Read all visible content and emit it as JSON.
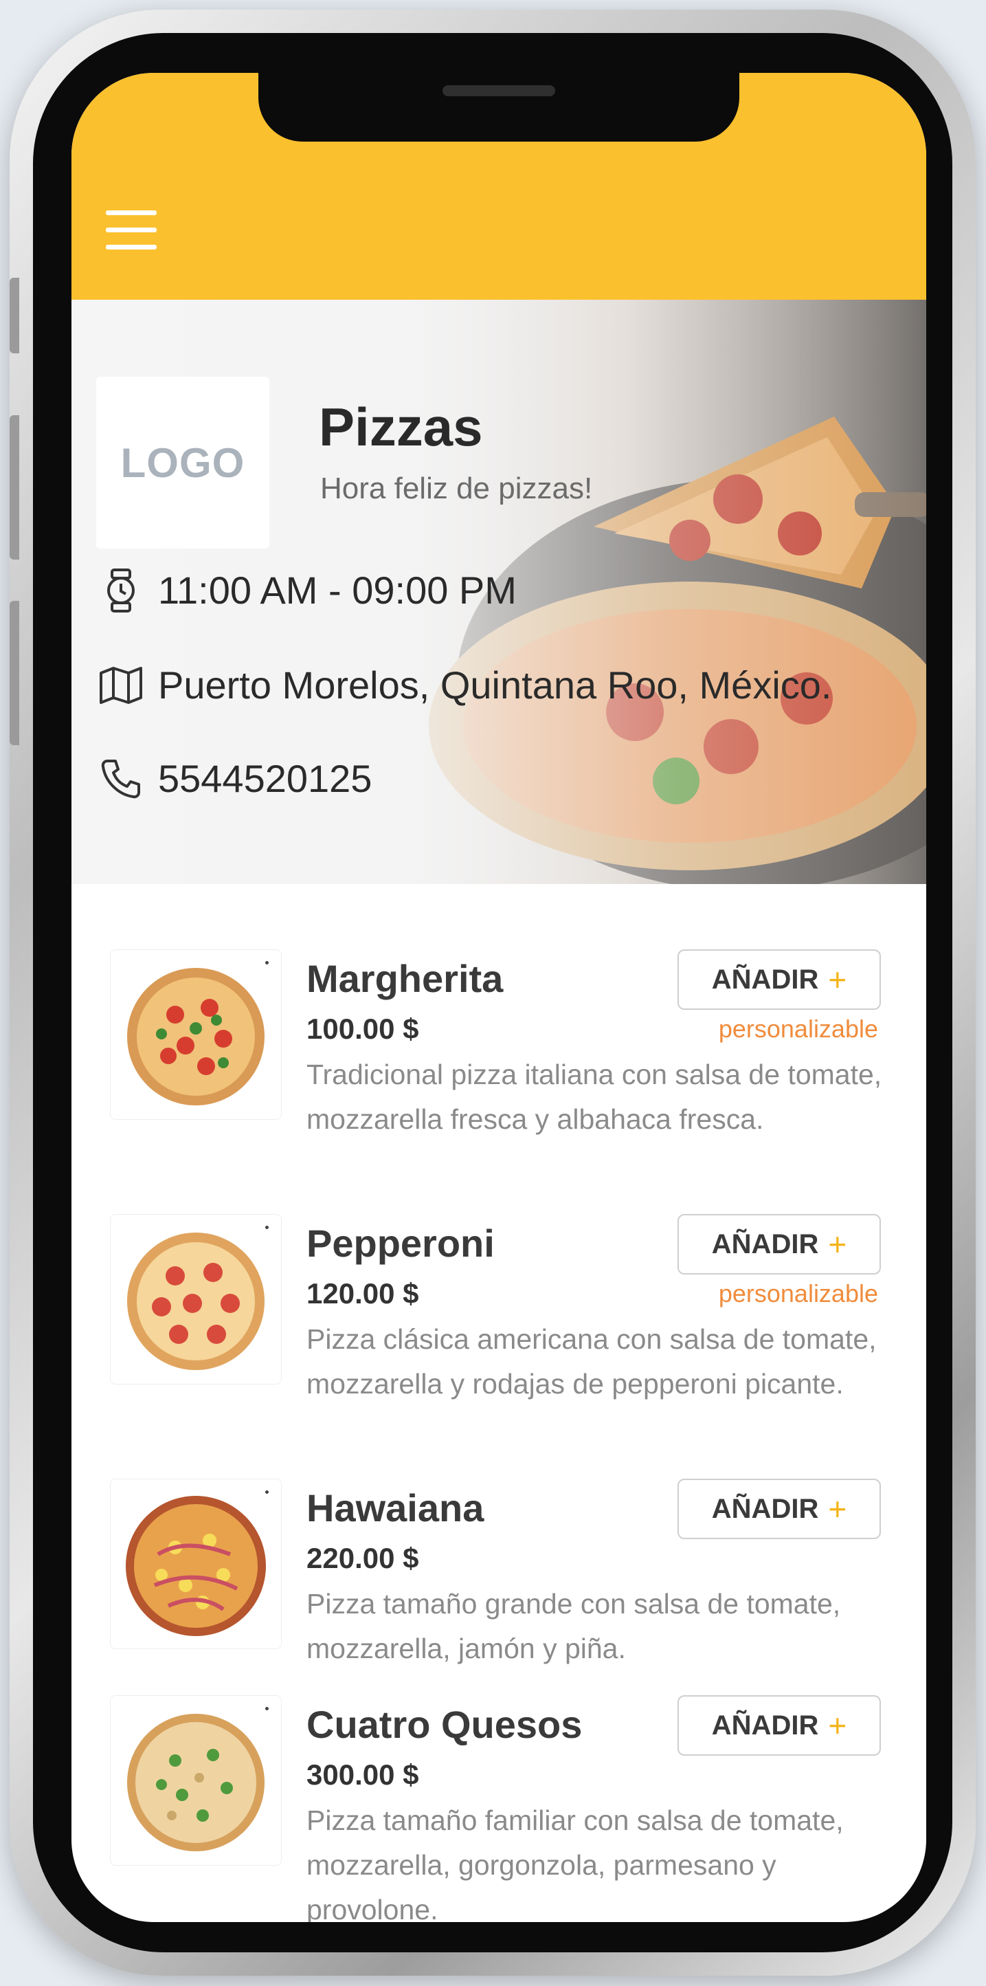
{
  "header": {
    "menu_icon": "hamburger-menu-icon",
    "bar_color": "#fbc02d"
  },
  "store": {
    "logo_text": "LOGO",
    "name": "Pizzas",
    "tagline": "Hora feliz de pizzas!",
    "hours": "11:00 AM - 09:00 PM",
    "address": "Puerto Morelos, Quintana Roo, México.",
    "phone": "5544520125"
  },
  "icons": {
    "hours": "watch-icon",
    "address": "map-icon",
    "phone": "phone-icon"
  },
  "accent_color": "#f4b51b",
  "tag_color": "#f08c3c",
  "menu": {
    "add_label": "AÑADIR",
    "add_symbol": "+",
    "customizable_label": "personalizable",
    "items": [
      {
        "name": "Margherita",
        "price": "100.00 $",
        "description": "Tradicional pizza italiana con salsa de tomate, mozzarella fresca y albahaca fresca.",
        "customizable": true
      },
      {
        "name": "Pepperoni",
        "price": "120.00 $",
        "description": "Pizza clásica americana con salsa de tomate, mozzarella y rodajas de pepperoni picante.",
        "customizable": true
      },
      {
        "name": "Hawaiana",
        "price": "220.00 $",
        "description": "Pizza tamaño grande con salsa de tomate, mozzarella, jamón y piña.",
        "customizable": false
      },
      {
        "name": "Cuatro Quesos",
        "price": "300.00 $",
        "description": "Pizza tamaño familiar con salsa de tomate, mozzarella, gorgonzola, parmesano y provolone.",
        "customizable": false
      }
    ]
  }
}
